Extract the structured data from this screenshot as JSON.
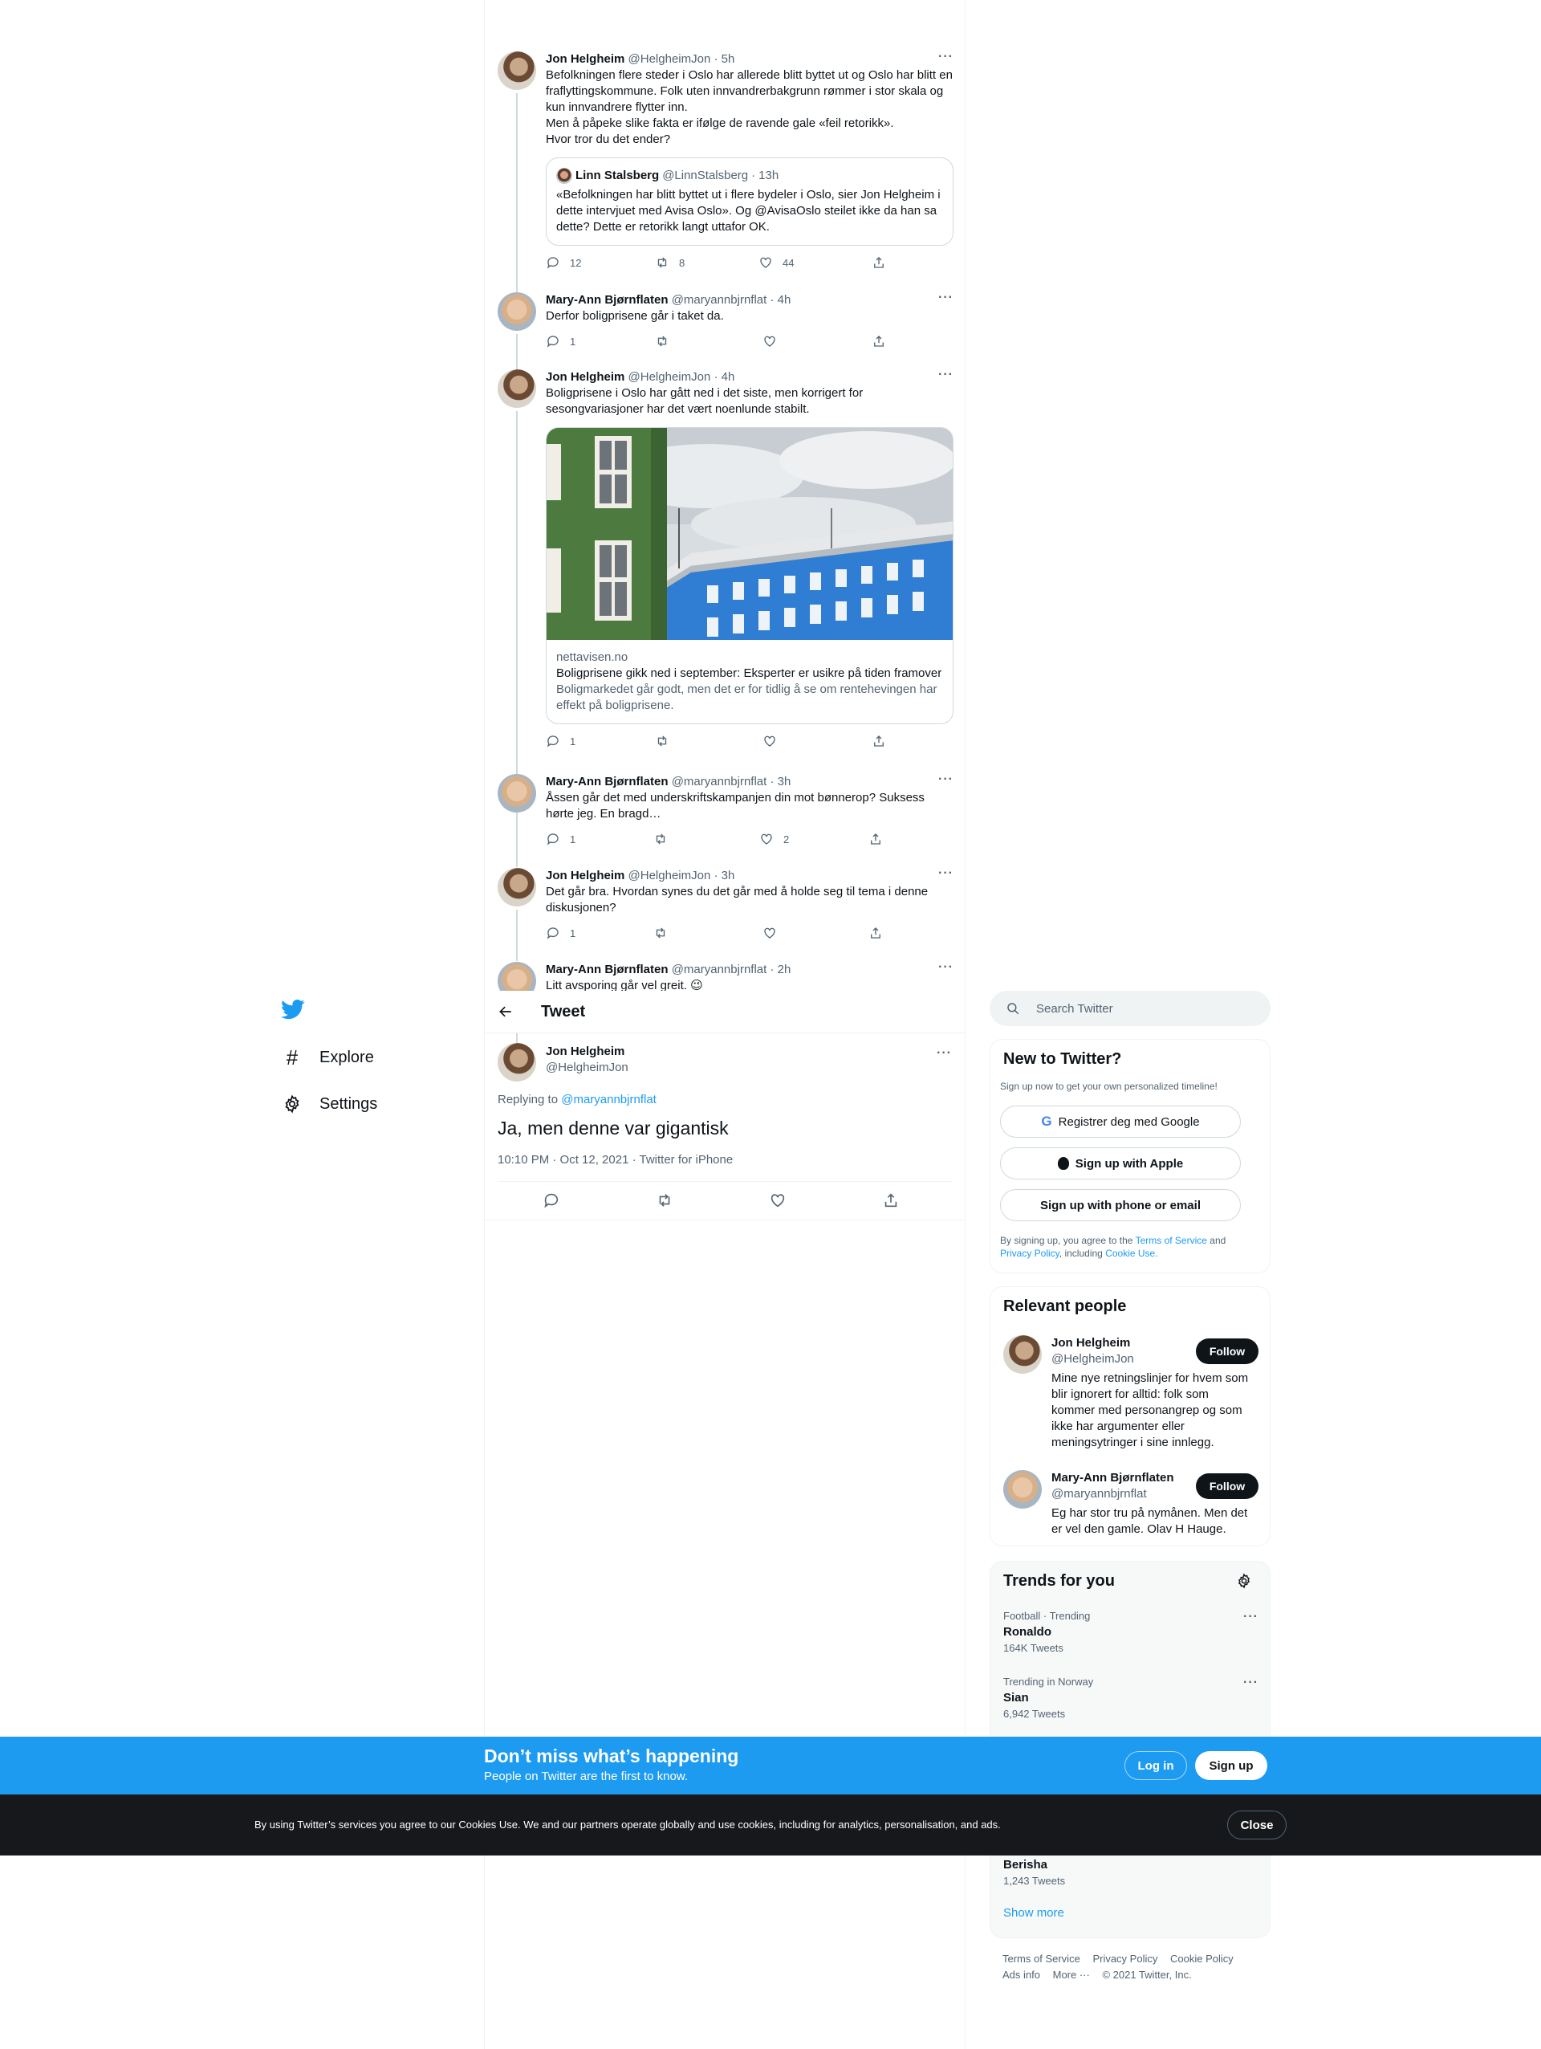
{
  "nav": {
    "items": [
      {
        "label": "Explore",
        "icon": "hashtag-icon"
      },
      {
        "label": "Settings",
        "icon": "gear-icon"
      }
    ]
  },
  "thread": [
    {
      "name": "Jon Helgheim",
      "handle": "@HelgheimJon",
      "dot": "·",
      "time": "5h",
      "text": "Befolkningen flere steder i Oslo har allerede blitt byttet ut og Oslo har blitt en fraflyttingskommune. Folk uten innvandrerbakgrunn rømmer i stor skala og kun innvandrere flytter inn.\nMen å påpeke slike fakta er ifølge de ravende gale «feil retorikk».\nHvor tror du det ender?",
      "quote": {
        "name": "Linn Stalsberg",
        "handle": "@LinnStalsberg",
        "dot": "·",
        "time": "13h",
        "text": "«Befolkningen har blitt byttet ut i flere bydeler i Oslo, sier Jon Helgheim i dette intervjuet med Avisa Oslo». Og @AvisaOslo steilet ikke da han sa dette? Dette er retorikk langt uttafor OK."
      },
      "replies": "12",
      "retweets": "8",
      "likes": "44"
    },
    {
      "name": "Mary-Ann Bjørnflaten",
      "handle": "@maryannbjrnflat",
      "dot": "·",
      "time": "4h",
      "text": "Derfor boligprisene går i taket da.",
      "replies": "1",
      "retweets": "",
      "likes": ""
    },
    {
      "name": "Jon Helgheim",
      "handle": "@HelgheimJon",
      "dot": "·",
      "time": "4h",
      "text": "Boligprisene i Oslo har gått ned i det siste, men korrigert for sesongvariasjoner har det vært noenlunde stabilt.",
      "card": {
        "domain": "nettavisen.no",
        "title": "Boligprisene gikk ned i september: Eksperter er usikre på tiden framover",
        "description": "Boligmarkedet går godt, men det er for tidlig å se om rentehevingen har effekt på boligprisene."
      },
      "replies": "1",
      "retweets": "",
      "likes": ""
    },
    {
      "name": "Mary-Ann Bjørnflaten",
      "handle": "@maryannbjrnflat",
      "dot": "·",
      "time": "3h",
      "text": "Åssen går det med underskriftskampanjen din mot bønnerop? Suksess hørte jeg. En bragd…",
      "replies": "1",
      "retweets": "",
      "likes": "2"
    },
    {
      "name": "Jon Helgheim",
      "handle": "@HelgheimJon",
      "dot": "·",
      "time": "3h",
      "text": "Det går bra. Hvordan synes du det går med å holde seg til tema i denne diskusjonen?",
      "replies": "1",
      "retweets": "",
      "likes": ""
    },
    {
      "name": "Mary-Ann Bjørnflaten",
      "handle": "@maryannbjrnflat",
      "dot": "·",
      "time": "2h",
      "text": "Litt avsporing går vel greit. 😉"
    }
  ],
  "header": {
    "title": "Tweet"
  },
  "focused": {
    "name": "Jon Helgheim",
    "handle": "@HelgheimJon",
    "replying_prefix": "Replying to",
    "replying_to": "@maryannbjrnflat",
    "text": "Ja, men denne var gigantisk",
    "meta": "10:10 PM · Oct 12, 2021 · Twitter for iPhone"
  },
  "search": {
    "placeholder": "Search Twitter"
  },
  "new_to_twitter": {
    "title": "New to Twitter?",
    "subtitle": "Sign up now to get your own personalized timeline!",
    "google": "Registrer deg med Google",
    "apple": "Sign up with Apple",
    "phone": "Sign up with phone or email",
    "legal_1": "By signing up, you agree to the",
    "terms": "Terms of Service",
    "legal_2": "and",
    "privacy": "Privacy Policy",
    "legal_3": ", including",
    "cookie": "Cookie Use."
  },
  "relevant_people": {
    "title": "Relevant people",
    "follow_label": "Follow",
    "people": [
      {
        "name": "Jon Helgheim",
        "handle": "@HelgheimJon",
        "bio": "Mine nye retningslinjer for hvem som blir ignorert for alltid: folk som kommer med personangrep og som ikke har argumenter eller meningsytringer i sine innlegg."
      },
      {
        "name": "Mary-Ann Bjørnflaten",
        "handle": "@maryannbjrnflat",
        "bio": "Eg har stor tru på nymånen. Men det er vel den gamle. Olav H Hauge."
      }
    ]
  },
  "trends": {
    "title": "Trends for you",
    "items": [
      {
        "category": "Football · Trending",
        "name": "Ronaldo",
        "count": "164K Tweets"
      },
      {
        "category": "Trending in Norway",
        "name": "Sian",
        "count": "6,942 Tweets"
      },
      {
        "category": "",
        "name": "Berisha",
        "count": "1,243 Tweets"
      }
    ],
    "show_more": "Show more"
  },
  "footer": {
    "links": [
      "Terms of Service",
      "Privacy Policy",
      "Cookie Policy",
      "Ads info",
      "More ···"
    ],
    "copyright": "© 2021 Twitter, Inc."
  },
  "login_banner": {
    "headline": "Don’t miss what’s happening",
    "sub": "People on Twitter are the first to know.",
    "login": "Log in",
    "signup": "Sign up"
  },
  "cookie_bar": {
    "text": "By using Twitter’s services you agree to our Cookies Use. We and our partners operate globally and use cookies, including for analytics, personalisation, and ads.",
    "close": "Close"
  },
  "colors": {
    "accent": "#1d9bf0",
    "text": "#0f1419",
    "muted": "#536471",
    "dark_bar": "#16181c"
  }
}
